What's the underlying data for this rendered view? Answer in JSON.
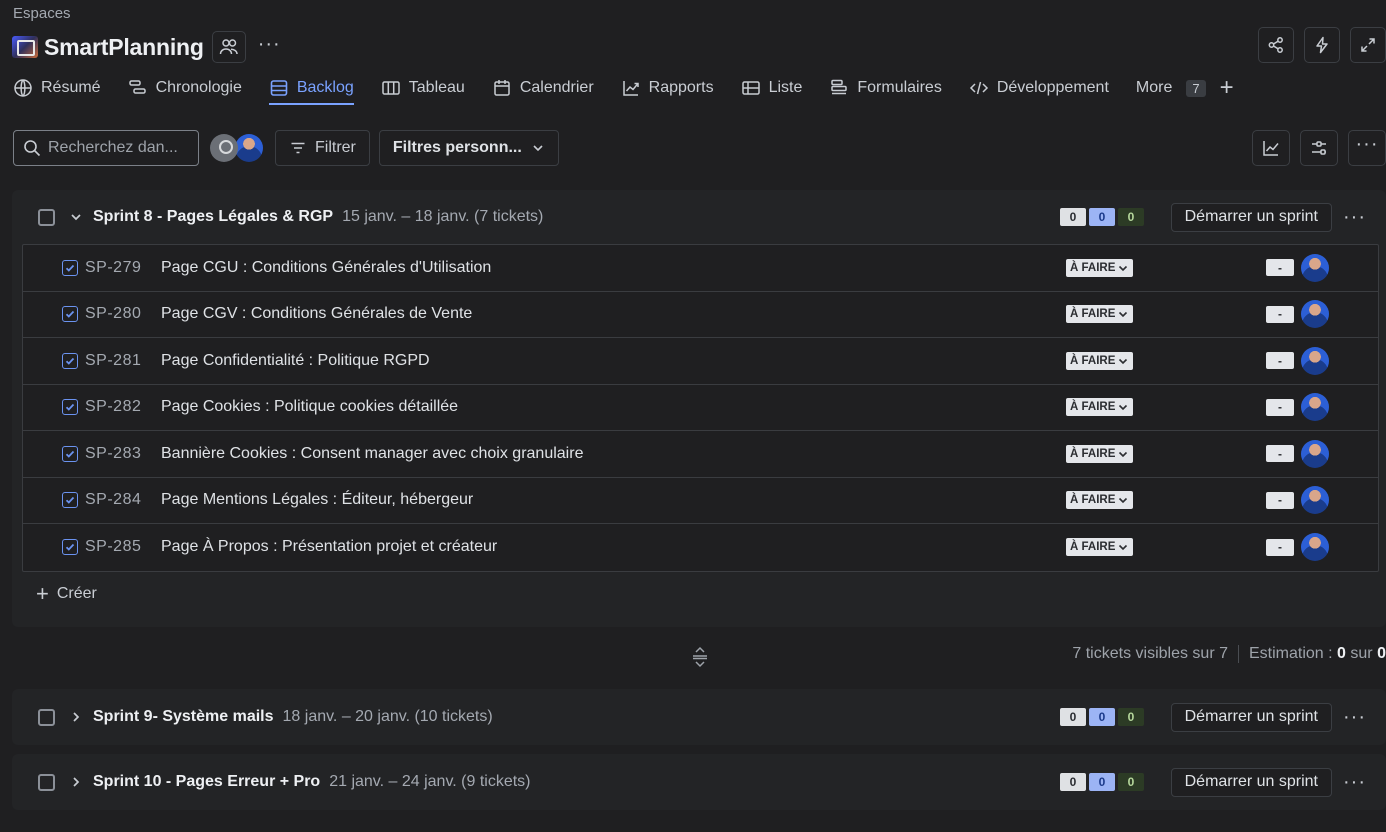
{
  "header": {
    "breadcrumb": "Espaces",
    "project_name": "SmartPlanning"
  },
  "tabs": [
    {
      "label": "Résumé",
      "icon": "globe-icon"
    },
    {
      "label": "Chronologie",
      "icon": "timeline-icon"
    },
    {
      "label": "Backlog",
      "icon": "backlog-icon",
      "active": true
    },
    {
      "label": "Tableau",
      "icon": "board-icon"
    },
    {
      "label": "Calendrier",
      "icon": "calendar-icon"
    },
    {
      "label": "Rapports",
      "icon": "chart-icon"
    },
    {
      "label": "Liste",
      "icon": "list-icon"
    },
    {
      "label": "Formulaires",
      "icon": "form-icon"
    },
    {
      "label": "Développement",
      "icon": "code-icon"
    }
  ],
  "more": {
    "label": "More",
    "count": "7"
  },
  "toolbar": {
    "search_placeholder": "Recherchez dan...",
    "filter_label": "Filtrer",
    "custom_filters_label": "Filtres personn..."
  },
  "active_sprint": {
    "title": "Sprint 8 - Pages Légales & RGP",
    "meta": "15 janv. – 18 janv. (7 tickets)",
    "counts": [
      "0",
      "0",
      "0"
    ],
    "start_label": "Démarrer un sprint",
    "issues": [
      {
        "key": "SP-279",
        "summary": "Page CGU : Conditions Générales d'Utilisation",
        "status": "À FAIRE",
        "estimate": "-"
      },
      {
        "key": "SP-280",
        "summary": "Page CGV : Conditions Générales de Vente",
        "status": "À FAIRE",
        "estimate": "-"
      },
      {
        "key": "SP-281",
        "summary": "Page Confidentialité : Politique RGPD",
        "status": "À FAIRE",
        "estimate": "-"
      },
      {
        "key": "SP-282",
        "summary": "Page Cookies : Politique cookies détaillée",
        "status": "À FAIRE",
        "estimate": "-"
      },
      {
        "key": "SP-283",
        "summary": "Bannière Cookies : Consent manager avec choix granulaire",
        "status": "À FAIRE",
        "estimate": "-"
      },
      {
        "key": "SP-284",
        "summary": "Page Mentions Légales : Éditeur, hébergeur",
        "status": "À FAIRE",
        "estimate": "-"
      },
      {
        "key": "SP-285",
        "summary": "Page À Propos : Présentation projet et créateur",
        "status": "À FAIRE",
        "estimate": "-"
      }
    ],
    "create_label": "Créer"
  },
  "summary": {
    "visible": "7 tickets visibles sur 7",
    "estimation_label": "Estimation :",
    "estimation_value": "0",
    "estimation_of": "sur",
    "estimation_total": "0"
  },
  "other_sprints": [
    {
      "title": "Sprint 9- Système mails",
      "meta": "18 janv. – 20 janv. (10 tickets)",
      "counts": [
        "0",
        "0",
        "0"
      ],
      "start_label": "Démarrer un sprint"
    },
    {
      "title": "Sprint 10 - Pages Erreur + Pro",
      "meta": "21 janv. – 24 janv. (9 tickets)",
      "counts": [
        "0",
        "0",
        "0"
      ],
      "start_label": "Démarrer un sprint"
    }
  ]
}
